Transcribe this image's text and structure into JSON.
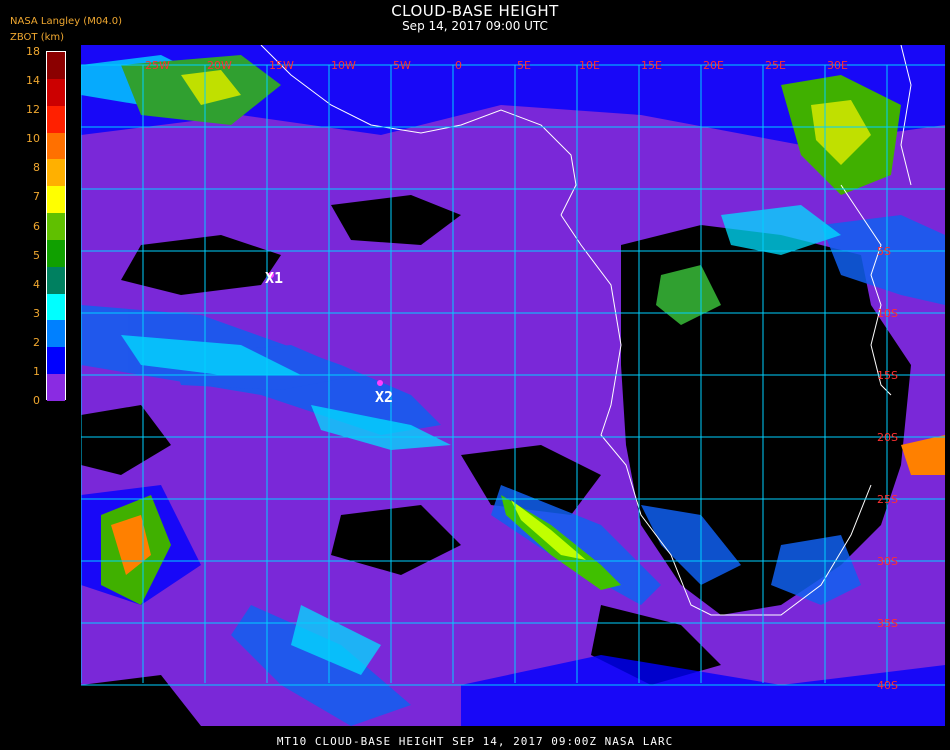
{
  "header": {
    "title": "CLOUD-BASE HEIGHT",
    "subtitle": "Sep 14, 2017 09:00 UTC",
    "org": "NASA Langley (M04.0)",
    "unit": "ZBOT (km)"
  },
  "legend": {
    "labels": [
      "18",
      "14",
      "12",
      "10",
      "8",
      "7",
      "6",
      "5",
      "4",
      "3",
      "2",
      "1",
      "0"
    ],
    "colors": [
      "#8b0000",
      "#cc0000",
      "#ff2000",
      "#ff7000",
      "#ffb000",
      "#ffff00",
      "#60c000",
      "#10a000",
      "#008060",
      "#00ffff",
      "#0080ff",
      "#0000ff",
      "#8a2be2"
    ]
  },
  "map": {
    "background": "#8a2be2",
    "grid_color": "#00d0ff",
    "lat_labels": [
      "5S",
      "10S",
      "15S",
      "20S",
      "25S",
      "30S",
      "35S",
      "40S"
    ],
    "lon_labels": [
      "25W",
      "20W",
      "15W",
      "10W",
      "5W",
      "0",
      "5E",
      "10E",
      "15E",
      "20E",
      "25E",
      "30E"
    ],
    "markers": [
      {
        "label": "X1"
      },
      {
        "label": "X2"
      }
    ]
  },
  "footer": {
    "text": "MT10  CLOUD-BASE HEIGHT   SEP 14, 2017 09:00Z   NASA LARC"
  }
}
